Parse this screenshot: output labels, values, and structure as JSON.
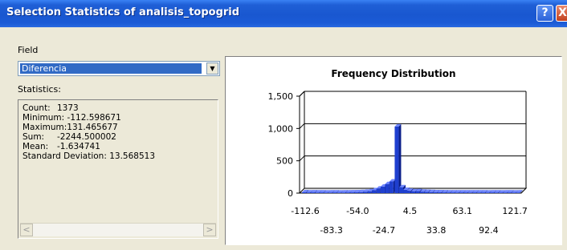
{
  "window": {
    "title": "Selection Statistics of analisis_topogrid",
    "help_label": "?",
    "close_label": "X"
  },
  "field": {
    "label": "Field",
    "selected": "Diferencia"
  },
  "statistics": {
    "label": "Statistics:",
    "rows": [
      {
        "key": "Count:",
        "value": "1373"
      },
      {
        "key": "Minimum:",
        "value": "-112.598671"
      },
      {
        "key": "Maximum:",
        "value": "131.465677"
      },
      {
        "key": "Sum:",
        "value": "-2244.500002"
      },
      {
        "key": "Mean:",
        "value": "-1.634741"
      },
      {
        "key": "Standard Deviation:",
        "value": "13.568513"
      }
    ],
    "scroll_left": "<",
    "scroll_right": ">"
  },
  "colors": {
    "bar": "#1f3fcf",
    "bar_dark": "#0b1f8a",
    "title_bar": "#1957d0",
    "selection": "#316ac5"
  },
  "chart_data": {
    "type": "bar",
    "title": "Frequency Distribution",
    "xlabel": "",
    "ylabel": "",
    "ylim": [
      0,
      1500
    ],
    "yticks": [
      "0",
      "500",
      "1,000",
      "1,500"
    ],
    "xticks_top": [
      "-112.6",
      "-54.0",
      "4.5",
      "63.1",
      "121.7"
    ],
    "xticks_bottom": [
      "-83.3",
      "-24.7",
      "33.8",
      "92.4"
    ],
    "grid": true,
    "bins": [
      {
        "x": -112.6,
        "y": 12
      },
      {
        "x": -107.7,
        "y": 10
      },
      {
        "x": -102.8,
        "y": 11
      },
      {
        "x": -97.9,
        "y": 9
      },
      {
        "x": -93.1,
        "y": 10
      },
      {
        "x": -88.2,
        "y": 8
      },
      {
        "x": -83.3,
        "y": 9
      },
      {
        "x": -78.4,
        "y": 10
      },
      {
        "x": -73.5,
        "y": 8
      },
      {
        "x": -68.6,
        "y": 9
      },
      {
        "x": -63.7,
        "y": 10
      },
      {
        "x": -58.9,
        "y": 11
      },
      {
        "x": -54.0,
        "y": 12
      },
      {
        "x": -49.1,
        "y": 15
      },
      {
        "x": -44.2,
        "y": 20
      },
      {
        "x": -39.3,
        "y": 28
      },
      {
        "x": -34.4,
        "y": 45
      },
      {
        "x": -29.5,
        "y": 70
      },
      {
        "x": -24.7,
        "y": 100
      },
      {
        "x": -19.8,
        "y": 140
      },
      {
        "x": -14.9,
        "y": 180
      },
      {
        "x": -9.0,
        "y": 1030
      },
      {
        "x": -4.0,
        "y": 90
      },
      {
        "x": 0.5,
        "y": 50
      },
      {
        "x": 4.5,
        "y": 35
      },
      {
        "x": 9.4,
        "y": 28
      },
      {
        "x": 14.3,
        "y": 30
      },
      {
        "x": 19.2,
        "y": 22
      },
      {
        "x": 24.0,
        "y": 18
      },
      {
        "x": 28.9,
        "y": 15
      },
      {
        "x": 33.8,
        "y": 12
      },
      {
        "x": 38.7,
        "y": 12
      },
      {
        "x": 43.6,
        "y": 11
      },
      {
        "x": 48.5,
        "y": 10
      },
      {
        "x": 53.4,
        "y": 10
      },
      {
        "x": 58.2,
        "y": 9
      },
      {
        "x": 63.1,
        "y": 10
      },
      {
        "x": 68.0,
        "y": 10
      },
      {
        "x": 72.9,
        "y": 9
      },
      {
        "x": 77.8,
        "y": 10
      },
      {
        "x": 82.7,
        "y": 9
      },
      {
        "x": 87.5,
        "y": 10
      },
      {
        "x": 92.4,
        "y": 8
      },
      {
        "x": 97.3,
        "y": 10
      },
      {
        "x": 102.2,
        "y": 9
      },
      {
        "x": 107.1,
        "y": 8
      },
      {
        "x": 112.0,
        "y": 9
      },
      {
        "x": 116.8,
        "y": 10
      },
      {
        "x": 121.7,
        "y": 8
      },
      {
        "x": 126.6,
        "y": 9
      }
    ]
  }
}
